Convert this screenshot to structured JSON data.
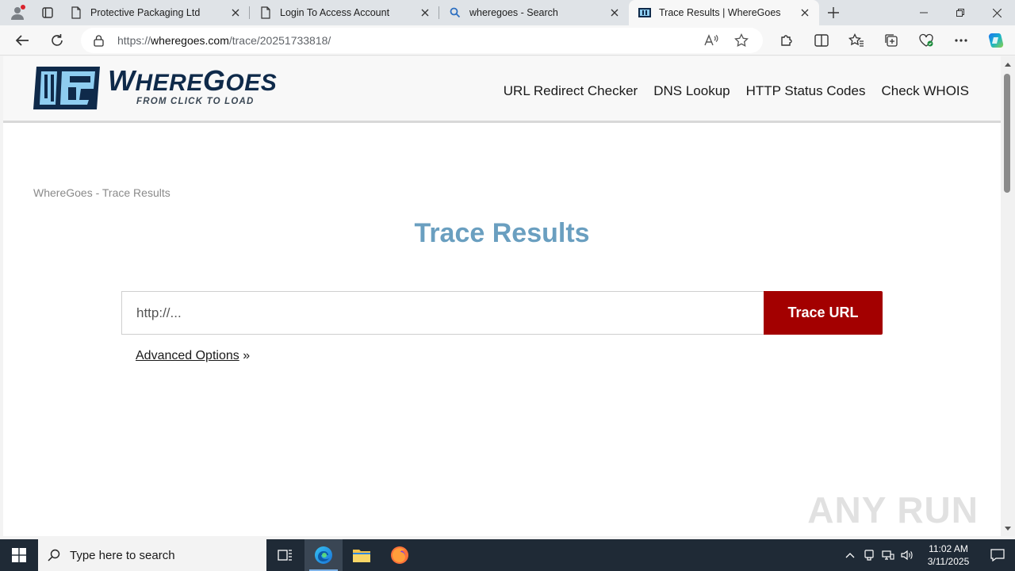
{
  "browser": {
    "tabs": [
      {
        "title": "Protective Packaging Ltd",
        "icon": "page-icon"
      },
      {
        "title": "Login To Access Account",
        "icon": "page-icon"
      },
      {
        "title": "wheregoes - Search",
        "icon": "search-icon"
      },
      {
        "title": "Trace Results | WhereGoes",
        "icon": "wheregoes-favicon",
        "active": true
      }
    ],
    "url_prefix": "https://",
    "url_domain": "wheregoes.com",
    "url_path": "/trace/20251733818/"
  },
  "site": {
    "logo_name_1": "W",
    "logo_name_2": "HERE",
    "logo_name_3": "G",
    "logo_name_4": "OES",
    "logo_tagline": "FROM CLICK TO LOAD",
    "nav": [
      "URL Redirect Checker",
      "DNS Lookup",
      "HTTP Status Codes",
      "Check WHOIS"
    ],
    "breadcrumb": "WhereGoes - Trace Results",
    "title": "Trace Results",
    "input_placeholder": "http://...",
    "trace_button": "Trace URL",
    "advanced_link": "Advanced Options",
    "advanced_suffix": " »",
    "watermark": "ANY RUN"
  },
  "taskbar": {
    "search_placeholder": "Type here to search",
    "time": "11:02 AM",
    "date": "3/11/2025"
  },
  "colors": {
    "brand_navy": "#0f2a4a",
    "title_blue": "#6a9fc0",
    "button_red": "#a30000"
  }
}
